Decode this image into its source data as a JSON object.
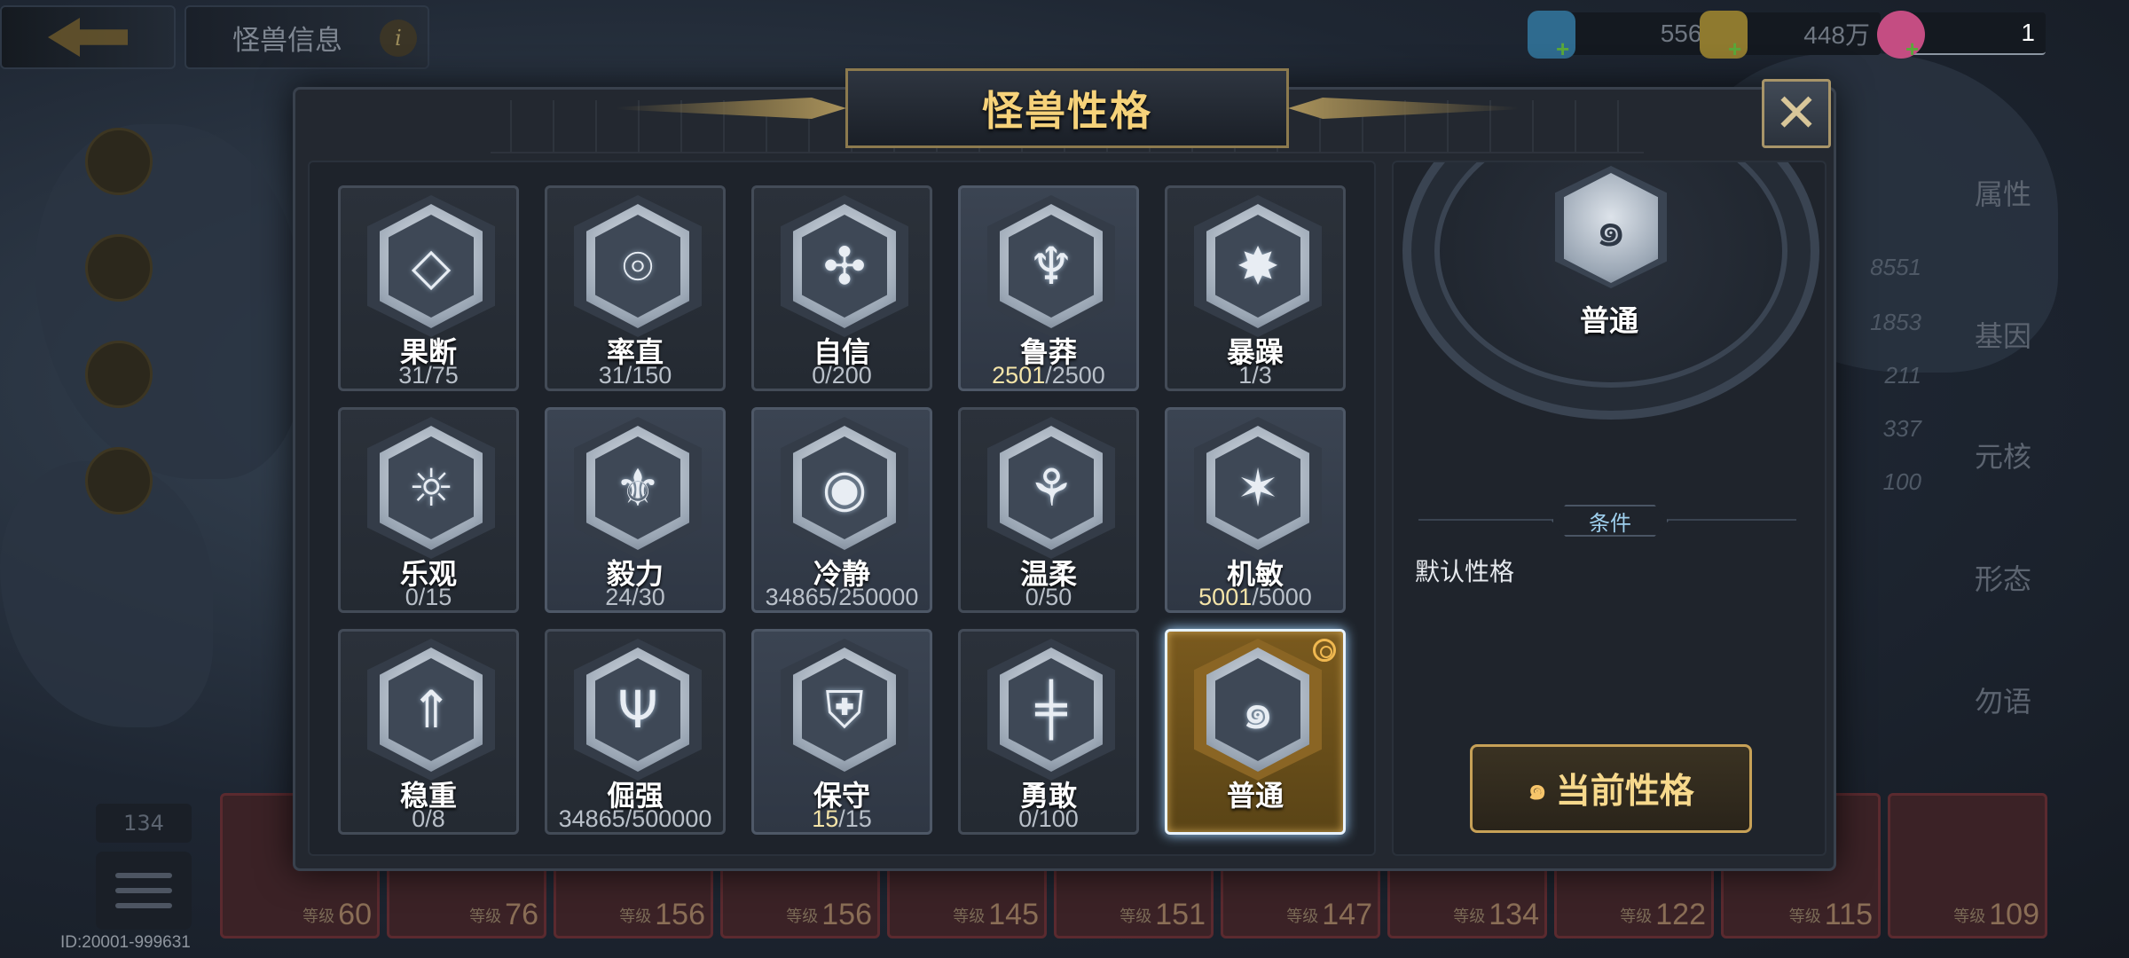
{
  "topbar": {
    "title": "怪兽信息",
    "info_icon": "i",
    "resources": [
      {
        "name": "gem-currency",
        "value": "5569",
        "color": "#3b7fa8"
      },
      {
        "name": "gold-currency",
        "value": "448万",
        "color": "#a8892f"
      },
      {
        "name": "summon-ticket",
        "value": "1",
        "color": "#d86a9a"
      }
    ]
  },
  "background": {
    "right_tabs": [
      "属性",
      "基因",
      "元核",
      "形态",
      "勿语"
    ],
    "right_stats": [
      "8551",
      "1853",
      "211",
      "337",
      "100"
    ],
    "roster_count": "134",
    "level_label": "等级",
    "roster_levels": [
      "60",
      "76",
      "156",
      "156",
      "145",
      "151",
      "147",
      "134",
      "122",
      "115",
      "109"
    ],
    "id_text": "ID:20001-999631"
  },
  "dialog": {
    "title": "怪兽性格",
    "close_label": "✕"
  },
  "traits": [
    {
      "name": "果断",
      "current": "31",
      "total": "75",
      "done": false,
      "glyph": "◇",
      "lit": false
    },
    {
      "name": "率直",
      "current": "31",
      "total": "150",
      "done": false,
      "glyph": "⌾",
      "lit": false
    },
    {
      "name": "自信",
      "current": "0",
      "total": "200",
      "done": false,
      "glyph": "✣",
      "lit": false
    },
    {
      "name": "鲁莽",
      "current": "2501",
      "total": "2500",
      "done": true,
      "glyph": "♆",
      "lit": true
    },
    {
      "name": "暴躁",
      "current": "1",
      "total": "3",
      "done": false,
      "glyph": "✸",
      "lit": false
    },
    {
      "name": "乐观",
      "current": "0",
      "total": "15",
      "done": false,
      "glyph": "☼",
      "lit": false
    },
    {
      "name": "毅力",
      "current": "24",
      "total": "30",
      "done": false,
      "glyph": "⚜",
      "lit": true
    },
    {
      "name": "冷静",
      "current": "34865",
      "total": "250000",
      "done": false,
      "glyph": "◉",
      "lit": true
    },
    {
      "name": "温柔",
      "current": "0",
      "total": "50",
      "done": false,
      "glyph": "⚘",
      "lit": false
    },
    {
      "name": "机敏",
      "current": "5001",
      "total": "5000",
      "done": true,
      "glyph": "✶",
      "lit": true
    },
    {
      "name": "稳重",
      "current": "0",
      "total": "8",
      "done": false,
      "glyph": "⇑",
      "lit": false
    },
    {
      "name": "倔强",
      "current": "34865",
      "total": "500000",
      "done": false,
      "glyph": "Ψ",
      "lit": false
    },
    {
      "name": "保守",
      "current": "15",
      "total": "15",
      "done": true,
      "glyph": "⛨",
      "lit": true
    },
    {
      "name": "勇敢",
      "current": "0",
      "total": "100",
      "done": false,
      "glyph": "╪",
      "lit": false
    },
    {
      "name": "普通",
      "current": "",
      "total": "",
      "done": false,
      "glyph": "๑",
      "lit": false,
      "selected": true
    }
  ],
  "detail": {
    "name": "普通",
    "glyph": "๑",
    "condition_label": "条件",
    "condition_text": "默认性格",
    "current_button": "当前性格",
    "spiral_icon": "๑"
  }
}
